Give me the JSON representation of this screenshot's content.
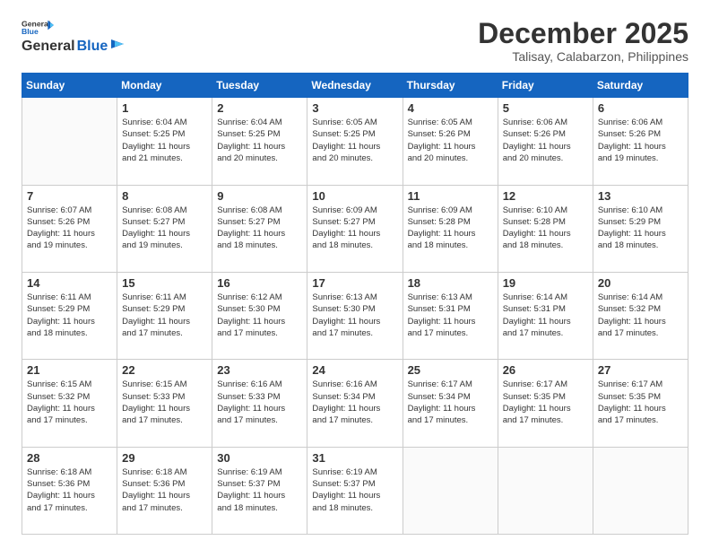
{
  "logo": {
    "line1": "General",
    "line2": "Blue"
  },
  "header": {
    "month": "December 2025",
    "location": "Talisay, Calabarzon, Philippines"
  },
  "weekdays": [
    "Sunday",
    "Monday",
    "Tuesday",
    "Wednesday",
    "Thursday",
    "Friday",
    "Saturday"
  ],
  "weeks": [
    [
      {
        "day": "",
        "info": ""
      },
      {
        "day": "1",
        "info": "Sunrise: 6:04 AM\nSunset: 5:25 PM\nDaylight: 11 hours\nand 21 minutes."
      },
      {
        "day": "2",
        "info": "Sunrise: 6:04 AM\nSunset: 5:25 PM\nDaylight: 11 hours\nand 20 minutes."
      },
      {
        "day": "3",
        "info": "Sunrise: 6:05 AM\nSunset: 5:25 PM\nDaylight: 11 hours\nand 20 minutes."
      },
      {
        "day": "4",
        "info": "Sunrise: 6:05 AM\nSunset: 5:26 PM\nDaylight: 11 hours\nand 20 minutes."
      },
      {
        "day": "5",
        "info": "Sunrise: 6:06 AM\nSunset: 5:26 PM\nDaylight: 11 hours\nand 20 minutes."
      },
      {
        "day": "6",
        "info": "Sunrise: 6:06 AM\nSunset: 5:26 PM\nDaylight: 11 hours\nand 19 minutes."
      }
    ],
    [
      {
        "day": "7",
        "info": "Sunrise: 6:07 AM\nSunset: 5:26 PM\nDaylight: 11 hours\nand 19 minutes."
      },
      {
        "day": "8",
        "info": "Sunrise: 6:08 AM\nSunset: 5:27 PM\nDaylight: 11 hours\nand 19 minutes."
      },
      {
        "day": "9",
        "info": "Sunrise: 6:08 AM\nSunset: 5:27 PM\nDaylight: 11 hours\nand 18 minutes."
      },
      {
        "day": "10",
        "info": "Sunrise: 6:09 AM\nSunset: 5:27 PM\nDaylight: 11 hours\nand 18 minutes."
      },
      {
        "day": "11",
        "info": "Sunrise: 6:09 AM\nSunset: 5:28 PM\nDaylight: 11 hours\nand 18 minutes."
      },
      {
        "day": "12",
        "info": "Sunrise: 6:10 AM\nSunset: 5:28 PM\nDaylight: 11 hours\nand 18 minutes."
      },
      {
        "day": "13",
        "info": "Sunrise: 6:10 AM\nSunset: 5:29 PM\nDaylight: 11 hours\nand 18 minutes."
      }
    ],
    [
      {
        "day": "14",
        "info": "Sunrise: 6:11 AM\nSunset: 5:29 PM\nDaylight: 11 hours\nand 18 minutes."
      },
      {
        "day": "15",
        "info": "Sunrise: 6:11 AM\nSunset: 5:29 PM\nDaylight: 11 hours\nand 17 minutes."
      },
      {
        "day": "16",
        "info": "Sunrise: 6:12 AM\nSunset: 5:30 PM\nDaylight: 11 hours\nand 17 minutes."
      },
      {
        "day": "17",
        "info": "Sunrise: 6:13 AM\nSunset: 5:30 PM\nDaylight: 11 hours\nand 17 minutes."
      },
      {
        "day": "18",
        "info": "Sunrise: 6:13 AM\nSunset: 5:31 PM\nDaylight: 11 hours\nand 17 minutes."
      },
      {
        "day": "19",
        "info": "Sunrise: 6:14 AM\nSunset: 5:31 PM\nDaylight: 11 hours\nand 17 minutes."
      },
      {
        "day": "20",
        "info": "Sunrise: 6:14 AM\nSunset: 5:32 PM\nDaylight: 11 hours\nand 17 minutes."
      }
    ],
    [
      {
        "day": "21",
        "info": "Sunrise: 6:15 AM\nSunset: 5:32 PM\nDaylight: 11 hours\nand 17 minutes."
      },
      {
        "day": "22",
        "info": "Sunrise: 6:15 AM\nSunset: 5:33 PM\nDaylight: 11 hours\nand 17 minutes."
      },
      {
        "day": "23",
        "info": "Sunrise: 6:16 AM\nSunset: 5:33 PM\nDaylight: 11 hours\nand 17 minutes."
      },
      {
        "day": "24",
        "info": "Sunrise: 6:16 AM\nSunset: 5:34 PM\nDaylight: 11 hours\nand 17 minutes."
      },
      {
        "day": "25",
        "info": "Sunrise: 6:17 AM\nSunset: 5:34 PM\nDaylight: 11 hours\nand 17 minutes."
      },
      {
        "day": "26",
        "info": "Sunrise: 6:17 AM\nSunset: 5:35 PM\nDaylight: 11 hours\nand 17 minutes."
      },
      {
        "day": "27",
        "info": "Sunrise: 6:17 AM\nSunset: 5:35 PM\nDaylight: 11 hours\nand 17 minutes."
      }
    ],
    [
      {
        "day": "28",
        "info": "Sunrise: 6:18 AM\nSunset: 5:36 PM\nDaylight: 11 hours\nand 17 minutes."
      },
      {
        "day": "29",
        "info": "Sunrise: 6:18 AM\nSunset: 5:36 PM\nDaylight: 11 hours\nand 17 minutes."
      },
      {
        "day": "30",
        "info": "Sunrise: 6:19 AM\nSunset: 5:37 PM\nDaylight: 11 hours\nand 18 minutes."
      },
      {
        "day": "31",
        "info": "Sunrise: 6:19 AM\nSunset: 5:37 PM\nDaylight: 11 hours\nand 18 minutes."
      },
      {
        "day": "",
        "info": ""
      },
      {
        "day": "",
        "info": ""
      },
      {
        "day": "",
        "info": ""
      }
    ]
  ]
}
